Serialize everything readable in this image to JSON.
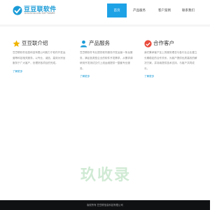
{
  "header": {
    "logo_name": "豆豆联软件",
    "logo_sub": "DOUDOULIAN SOFTWARE"
  },
  "nav": {
    "items": [
      {
        "label": "首页",
        "active": true
      },
      {
        "label": "产品服务",
        "active": false
      },
      {
        "label": "客户案例",
        "active": false
      },
      {
        "label": "联系我们",
        "active": false
      }
    ]
  },
  "columns": [
    {
      "icon": "star-icon",
      "title": "豆豆联介绍",
      "text": "豆豆联软件信息科技有限公司致力于软件开发运营等科技相关服务。以专业、诚信、高效为宗旨服务于广大客户，处理好各项目的完成。",
      "more": "了解更多"
    },
    {
      "icon": "person-icon",
      "title": "产品服务",
      "text": "豆豆联软件专业提供软件服务开发运营一条龙服务，满足各类型企业的软件开发需求，从需求调研到开发测试交付上线运维提供一整套专业服务。",
      "more": "了解更多"
    },
    {
      "icon": "handshake-icon",
      "title": "合作客户",
      "text": "我们秉承客户至上的服务理念与各行业企业建立长期稳定的合作关系，为客户提供优质高效的解决方案，并持续提供技术支持，与客户共同成长。",
      "more": "了解更多"
    }
  ],
  "footer": {
    "text": "版权所有 豆豆联信息科技有限公司"
  },
  "watermark": "玖收录",
  "colors": {
    "accent": "#1ea2e6",
    "footer_bg": "#0f1113",
    "icon_gold": "#f0b400",
    "icon_blue": "#1a9bd7",
    "icon_red": "#e94b3c"
  }
}
